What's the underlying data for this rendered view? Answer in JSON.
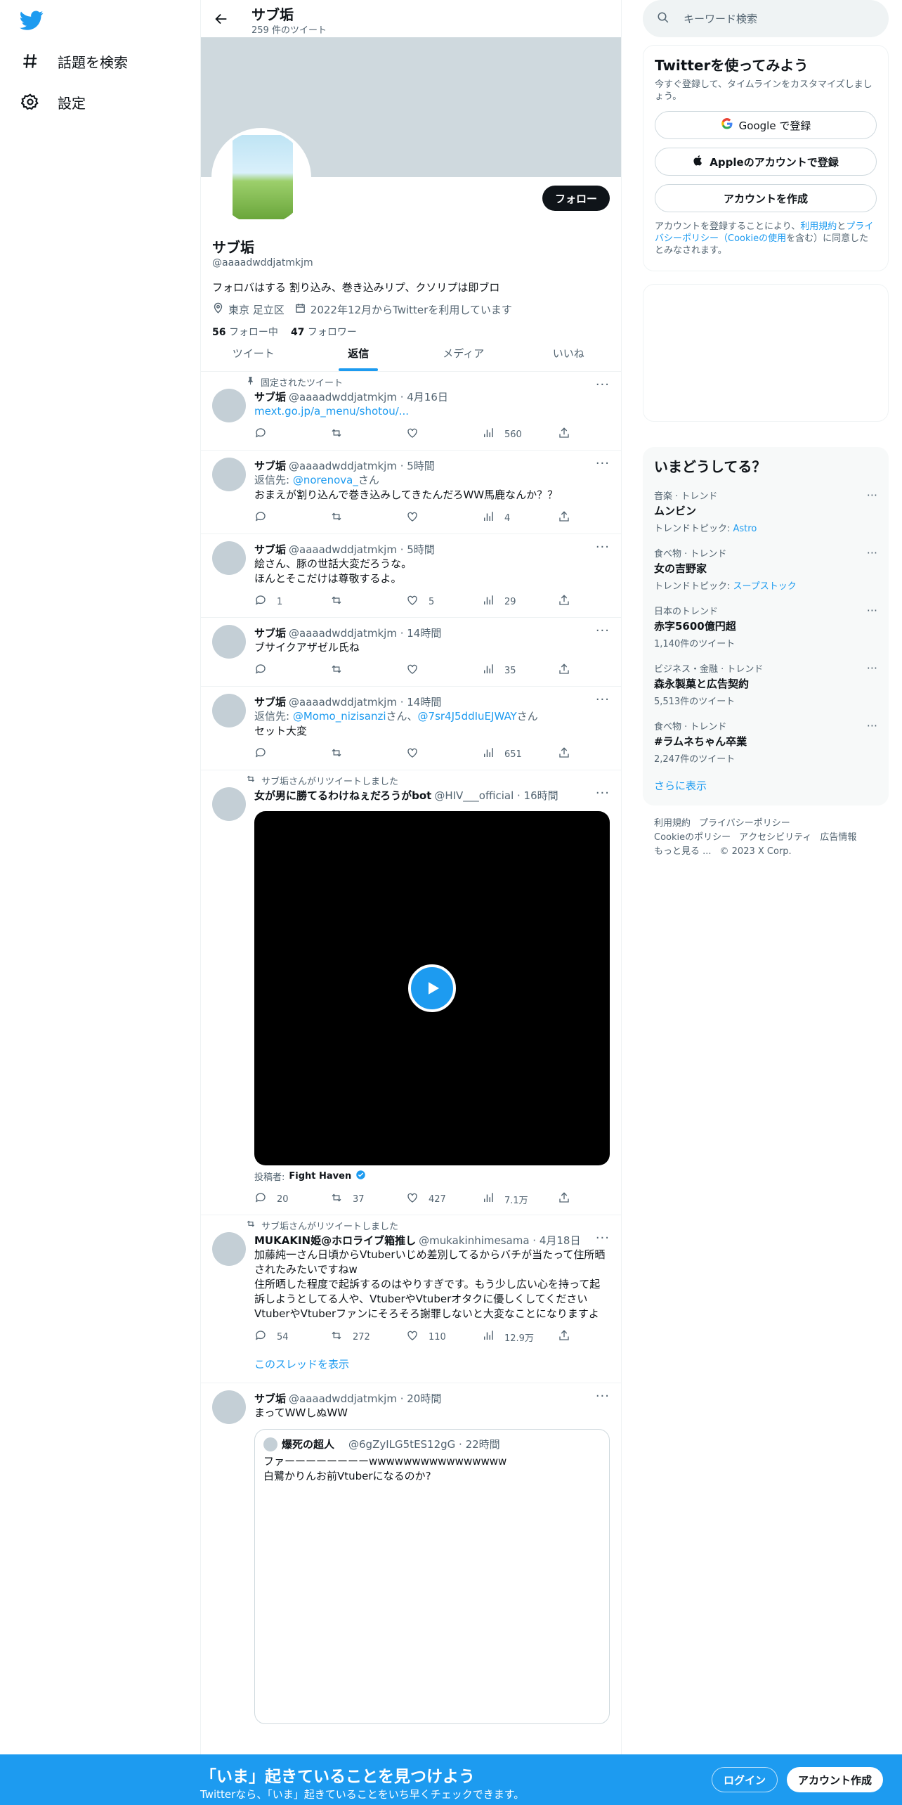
{
  "nav": {
    "explore": "話題を検索",
    "settings": "設定"
  },
  "profile_header": {
    "title": "サブ垢",
    "tweet_count": "259 件のツイート"
  },
  "profile": {
    "follow_button": "フォロー",
    "name": "サブ垢",
    "handle": "@aaaadwddjatmkjm",
    "bio": "フォロバはする 割り込み、巻き込みリプ、クソリプは即ブロ",
    "location": "東京 足立区",
    "joined": "2022年12月からTwitterを利用しています",
    "following_count": "56",
    "following_label": "フォロー中",
    "followers_count": "47",
    "followers_label": "フォロワー"
  },
  "tabs": [
    "ツイート",
    "返信",
    "メディア",
    "いいね"
  ],
  "tweets": [
    {
      "context": "固定されたツイート",
      "name": "サブ垢",
      "handle": "@aaaadwddjatmkjm · 4月16日",
      "link": "mext.go.jp/a_menu/shotou/...",
      "replies": "",
      "retweets": "",
      "likes": "",
      "views": "560"
    },
    {
      "name": "サブ垢",
      "handle": "@aaaadwddjatmkjm · 5時間",
      "reply_prefix": "返信先: ",
      "reply_to": "@norenova_",
      "reply_suffix": "さん",
      "text": "おまえが割り込んで巻き込みしてきたんだろWW馬鹿なんか？？",
      "replies": "",
      "retweets": "",
      "likes": "",
      "views": "4"
    },
    {
      "name": "サブ垢",
      "handle": "@aaaadwddjatmkjm · 5時間",
      "text": "絵さん、豚の世話大変だろうな。\nほんとそこだけは尊敬するよ。",
      "replies": "1",
      "retweets": "",
      "likes": "5",
      "views": "29"
    },
    {
      "name": "サブ垢",
      "handle": "@aaaadwddjatmkjm · 14時間",
      "text": "ブサイクアザゼル氏ね",
      "replies": "",
      "retweets": "",
      "likes": "",
      "views": "35"
    },
    {
      "name": "サブ垢",
      "handle": "@aaaadwddjatmkjm · 14時間",
      "reply_prefix": "返信先: ",
      "reply_to": "@Momo_nizisanzi",
      "reply_mid": "さん、",
      "reply_to2": "@7sr4J5ddIuEJWAY",
      "reply_suffix": "さん",
      "text": "セット大変",
      "replies": "",
      "retweets": "",
      "likes": "",
      "views": "651"
    },
    {
      "context": "サブ垢さんがリツイートしました",
      "name": "女が男に勝てるわけねぇだろうがbot",
      "handle": "@HIV___official · 16時間",
      "poster_label": "投稿者:",
      "poster_name": "Fight Haven",
      "replies": "20",
      "retweets": "37",
      "likes": "427",
      "views": "7.1万"
    },
    {
      "context": "サブ垢さんがリツイートしました",
      "name": "MUKAKIN姫@ホロライブ箱推し",
      "handle": "@mukakinhimesama · 4月18日",
      "text": "加藤純一さん日頃からVtuberいじめ差別してるからバチが当たって住所晒されたみたいですねw\n住所晒した程度で起訴するのはやりすぎです。もう少し広い心を持って起訴しようとしてる人や、VtuberやVtuberオタクに優しくしてください\nVtuberやVtuberファンにそろそろ謝罪しないと大変なことになりますよ",
      "replies": "54",
      "retweets": "272",
      "likes": "110",
      "views": "12.9万",
      "thread_link": "このスレッドを表示"
    },
    {
      "name": "サブ垢",
      "handle": "@aaaadwddjatmkjm · 20時間",
      "text": "まってWWしぬWW",
      "quote_name": "爆死の超人",
      "quote_handle": "@6gZyILG5tES12gG · 22時間",
      "quote_text": "ファーーーーーーーーwwwwwwwwwwwwwwww\n白鷺かりんお前Vtuberになるのか?"
    }
  ],
  "search": {
    "placeholder": "キーワード検索"
  },
  "signup": {
    "title": "Twitterを使ってみよう",
    "desc": "今すぐ登録して、タイムラインをカスタマイズしましょう。",
    "google": "Google で登録",
    "apple": "Appleのアカウントで登録",
    "create": "アカウントを作成",
    "terms_1": "アカウントを登録することにより、",
    "terms_link1": "利用規約",
    "terms_2": "と",
    "terms_link2": "プライバシーポリシー（Cookieの使用",
    "terms_3": "を含む）に同意したとみなされます。"
  },
  "trends": {
    "title": "いまどうしてる？",
    "items": [
      {
        "category": "音楽 · トレンド",
        "name": "ムンビン",
        "meta_label": "トレンドトピック: ",
        "meta_link": "Astro"
      },
      {
        "category": "食べ物 · トレンド",
        "name": "女の吉野家",
        "meta_label": "トレンドトピック: ",
        "meta_link": "スープストック"
      },
      {
        "category": "日本のトレンド",
        "name": "赤字5600億円超",
        "meta": "1,140件のツイート"
      },
      {
        "category": "ビジネス・金融 · トレンド",
        "name": "森永製菓と広告契約",
        "meta": "5,513件のツイート"
      },
      {
        "category": "食べ物 · トレンド",
        "name": "#ラムネちゃん卒業",
        "meta": "2,247件のツイート"
      }
    ],
    "show_more": "さらに表示"
  },
  "footer": {
    "links": [
      "利用規約",
      "プライバシーポリシー",
      "Cookieのポリシー",
      "アクセシビリティ",
      "広告情報",
      "もっと見る ..."
    ],
    "copyright": "© 2023 X Corp."
  },
  "bottom_bar": {
    "headline": "「いま」起きていることを見つけよう",
    "sub": "Twitterなら、「いま」起きていることをいち早くチェックできます。",
    "login": "ログイン",
    "signup": "アカウント作成"
  },
  "colors": {
    "accent": "#1d9bf0",
    "text": "#0f1419",
    "muted": "#536471",
    "banner": "#cfd9de"
  }
}
